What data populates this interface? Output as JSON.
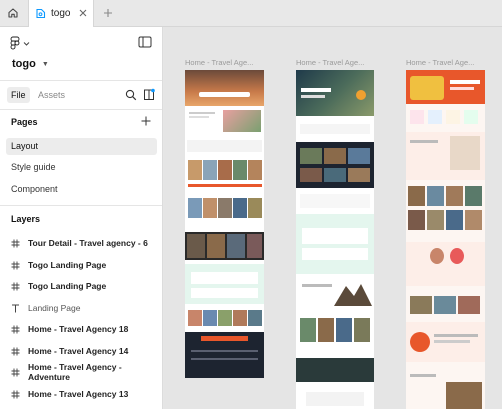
{
  "tabbar": {
    "active_tab": "togo"
  },
  "sidebar": {
    "project_name": "togo",
    "file_tab": "File",
    "assets_tab": "Assets",
    "pages_title": "Pages",
    "pages": [
      "Layout",
      "Style guide",
      "Component"
    ],
    "active_page": "Layout",
    "layers_title": "Layers",
    "layers": [
      {
        "name": "Tour Detail - Travel agency - 6",
        "icon": "frame-icon"
      },
      {
        "name": "Togo Landing Page",
        "icon": "frame-icon"
      },
      {
        "name": "Togo Landing Page",
        "icon": "frame-icon"
      },
      {
        "name": "Landing Page",
        "icon": "text-icon"
      },
      {
        "name": "Home - Travel Agency 18",
        "icon": "frame-icon"
      },
      {
        "name": "Home - Travel Agency 14",
        "icon": "frame-icon"
      },
      {
        "name": "Home - Travel Agency - Adventure",
        "icon": "frame-icon"
      },
      {
        "name": "Home - Travel Agency 13",
        "icon": "frame-icon"
      }
    ]
  },
  "canvas": {
    "frames": [
      {
        "label": "Home - Travel Age..."
      },
      {
        "label": "Home - Travel Age..."
      },
      {
        "label": "Home - Travel Age..."
      }
    ]
  },
  "colors": {
    "accent_blue": "#0d99ff",
    "brand_orange": "#e8572b",
    "dark_navy": "#1d2430",
    "mint": "#e4f6ee",
    "peach": "#fdeee8"
  }
}
